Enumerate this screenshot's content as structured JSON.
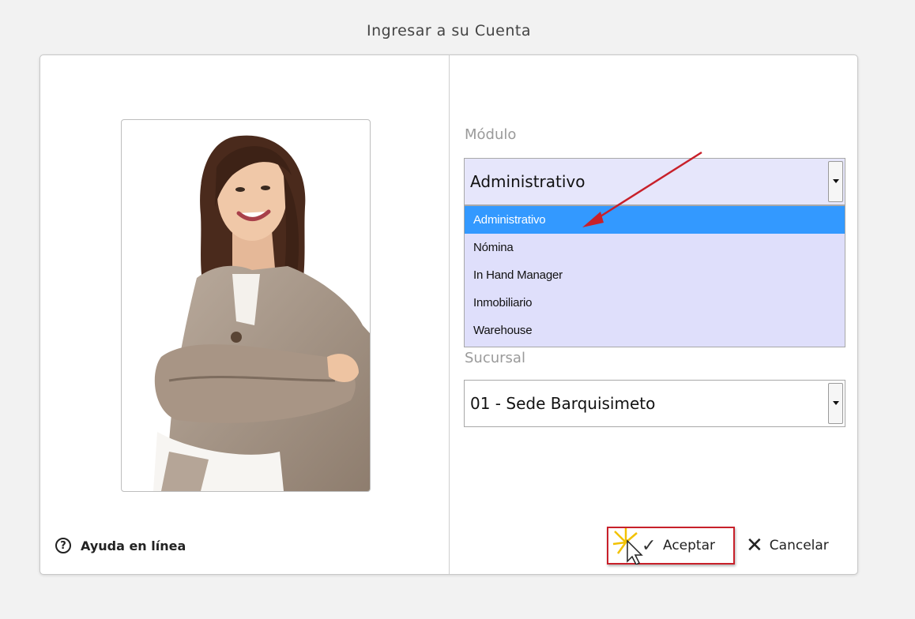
{
  "page": {
    "title": "Ingresar a su Cuenta"
  },
  "left": {
    "help_label": "Ayuda en línea",
    "help_icon": "?"
  },
  "modulo": {
    "label": "Módulo",
    "value": "Administrativo",
    "options": [
      "Administrativo",
      "Nómina",
      "In Hand Manager",
      "Inmobiliario",
      "Warehouse"
    ],
    "selected_index": 0
  },
  "sucursal": {
    "label": "Sucursal",
    "value": "01 - Sede Barquisimeto"
  },
  "buttons": {
    "accept": "Aceptar",
    "cancel": "Cancelar"
  },
  "colors": {
    "option_highlight": "#3399ff",
    "dropdown_bg": "#dfdffb",
    "annotation_red": "#c8202a"
  }
}
